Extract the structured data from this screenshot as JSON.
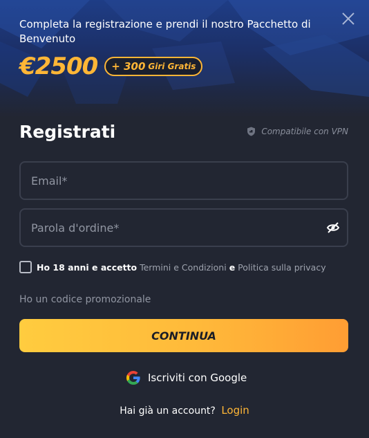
{
  "banner": {
    "text": "Completa la registrazione e prendi il nostro Pacchetto di Benvenuto",
    "bonus_amount": "€2500",
    "bonus_extra_number": "+ 300",
    "bonus_extra_text": "Giri Gratis"
  },
  "form": {
    "title": "Registrati",
    "vpn_label": "Compatibile con VPN",
    "email_placeholder": "Email*",
    "password_placeholder": "Parola d'ordine*",
    "terms": {
      "prefix": "Ho 18 anni e accetto",
      "terms_link": "Termini e Condizioni",
      "conjunction": "e",
      "privacy_link": "Politica sulla privacy"
    },
    "promo_label": "Ho un codice promozionale",
    "continue_label": "CONTINUA",
    "google_label": "Iscriviti con Google",
    "account_question": "Hai già un account?",
    "login_label": "Login"
  },
  "colors": {
    "accent": "#ffb636",
    "background": "#222632",
    "banner": "#1e3d86",
    "border": "#3a3f4d",
    "muted": "#9196a2"
  },
  "icons": [
    "close-icon",
    "shield-icon",
    "eye-off-icon",
    "google-icon"
  ]
}
